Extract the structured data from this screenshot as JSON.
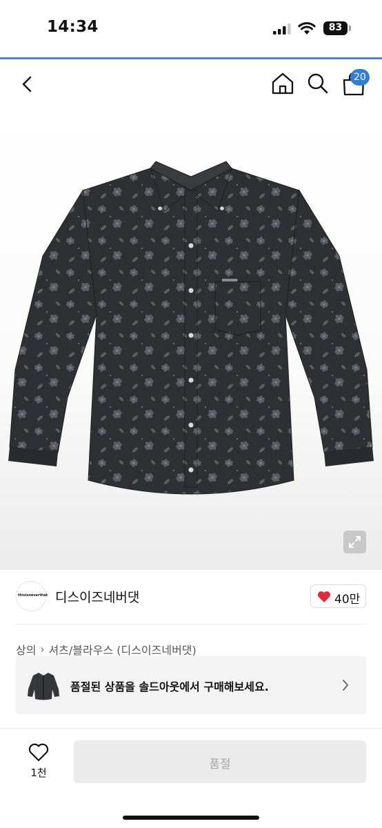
{
  "status_bar": {
    "time": "14:34",
    "battery": "83"
  },
  "header": {
    "back_icon": "chevron-left-icon",
    "home_icon": "home-icon",
    "search_icon": "search-icon",
    "bag_icon": "shopping-bag-icon",
    "bag_count": "20"
  },
  "product": {
    "image": "black floral jacquard denim long-sleeve button-down shirt",
    "zoom_icon": "expand-icon"
  },
  "brand": {
    "logo_text": "thisisneverthat",
    "name": "디스이즈네버댓",
    "like_icon": "heart-icon",
    "like_count": "40만"
  },
  "breadcrumb": {
    "category": "상의",
    "subcategory": "셔츠/블라우스 (디스이즈네버댓)"
  },
  "soldout_banner": {
    "text": "품절된 상품을 솔드아웃에서 구매해보세요."
  },
  "bottom_bar": {
    "wish_count": "1천",
    "button_label": "품절"
  },
  "colors": {
    "accent_blue": "#2f7fd6",
    "heart_red": "#e02a36",
    "disabled_button": "#ebebeb"
  }
}
